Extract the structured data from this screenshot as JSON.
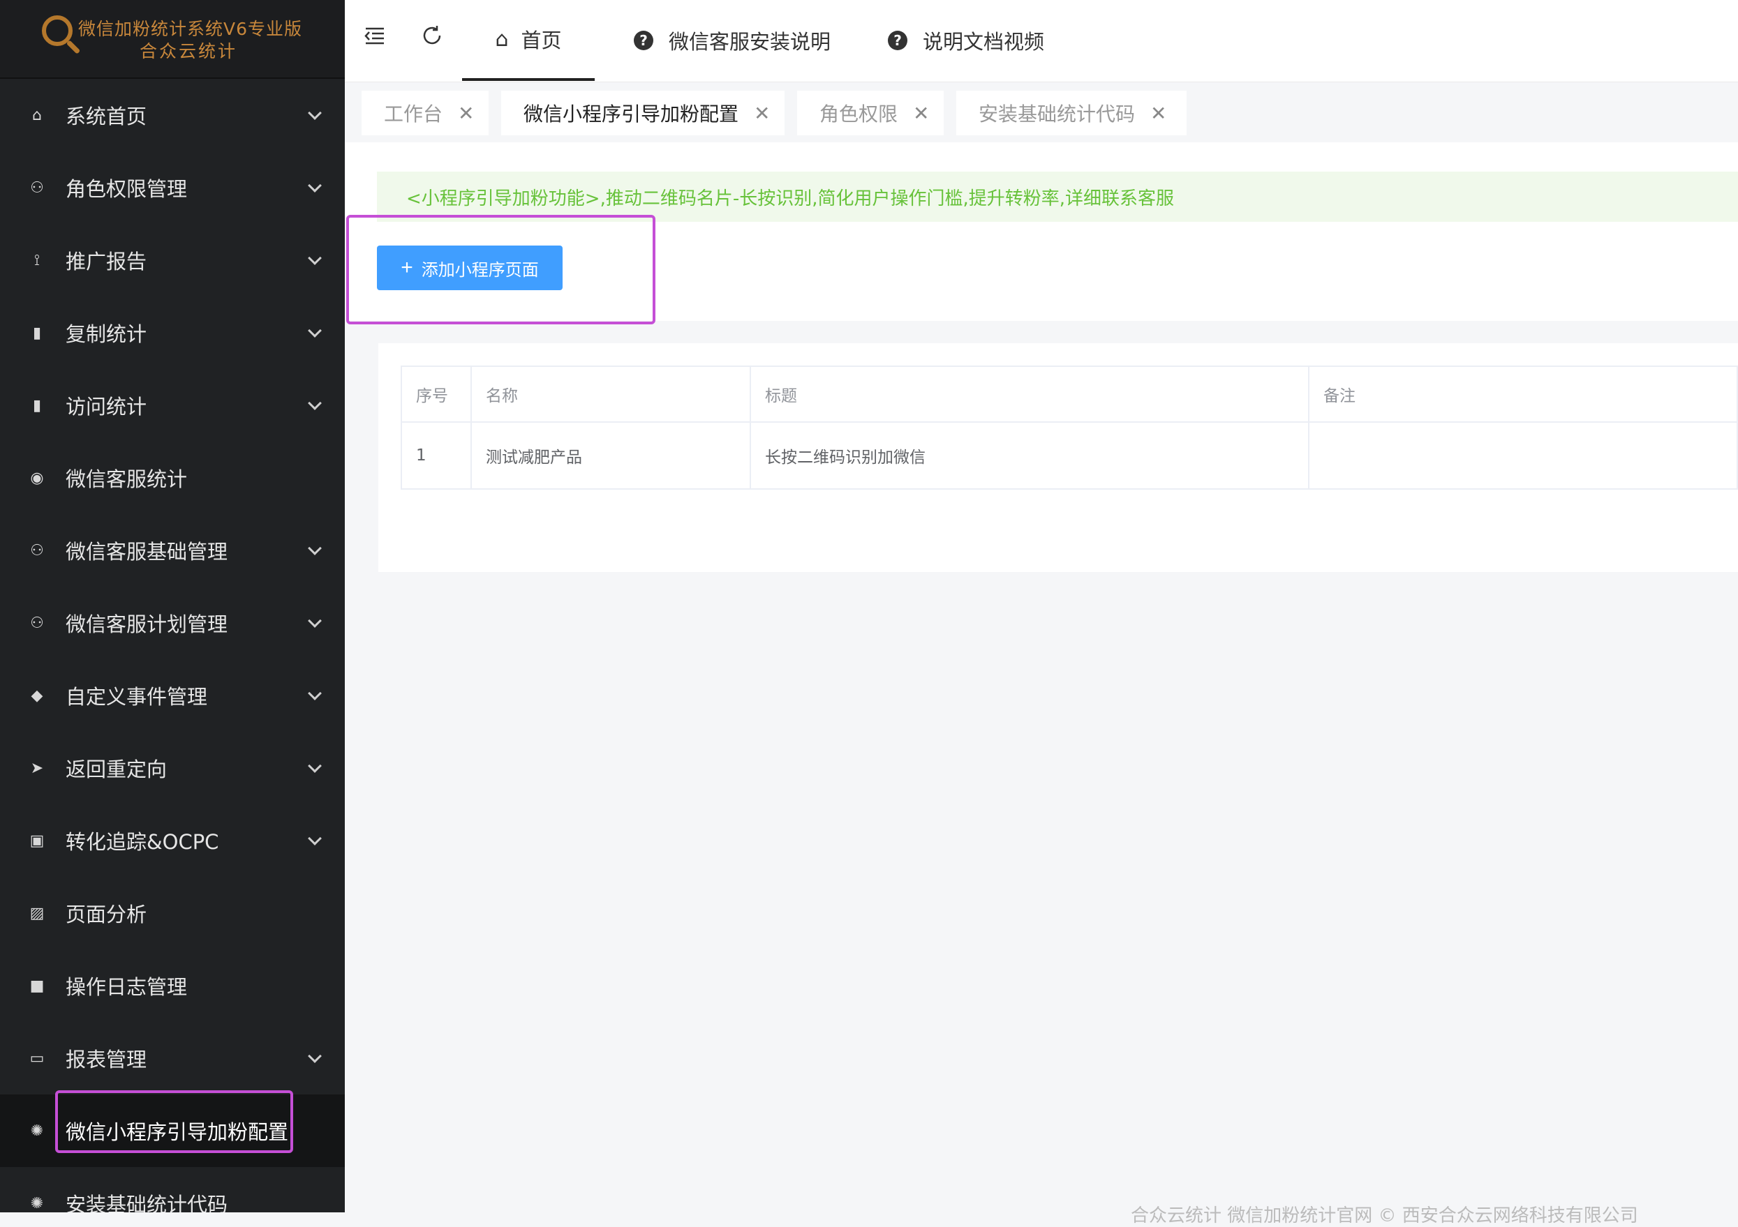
{
  "logo": {
    "line1": "微信加粉统计系统V6专业版",
    "line2": "合众云统计"
  },
  "sidebar": {
    "items": [
      {
        "label": "系统首页",
        "icon": "home-icon",
        "glyph": "⌂",
        "expandable": true
      },
      {
        "label": "角色权限管理",
        "icon": "user-add-icon",
        "glyph": "⚇",
        "expandable": true
      },
      {
        "label": "推广报告",
        "icon": "route-icon",
        "glyph": "⟟",
        "expandable": true
      },
      {
        "label": "复制统计",
        "icon": "bar-chart-icon",
        "glyph": "▮",
        "expandable": true
      },
      {
        "label": "访问统计",
        "icon": "stats-icon",
        "glyph": "▮",
        "expandable": true
      },
      {
        "label": "微信客服统计",
        "icon": "user-circle-icon",
        "glyph": "◉",
        "expandable": false
      },
      {
        "label": "微信客服基础管理",
        "icon": "users-icon",
        "glyph": "⚇",
        "expandable": true
      },
      {
        "label": "微信客服计划管理",
        "icon": "group-icon",
        "glyph": "⚇",
        "expandable": true
      },
      {
        "label": "自定义事件管理",
        "icon": "cube-icon",
        "glyph": "◆",
        "expandable": true
      },
      {
        "label": "返回重定向",
        "icon": "send-icon",
        "glyph": "➤",
        "expandable": true
      },
      {
        "label": "转化追踪&OCPC",
        "icon": "inbox-icon",
        "glyph": "▣",
        "expandable": true
      },
      {
        "label": "页面分析",
        "icon": "chart-picture-icon",
        "glyph": "▨",
        "expandable": false
      },
      {
        "label": "操作日志管理",
        "icon": "video-icon",
        "glyph": "■",
        "expandable": false
      },
      {
        "label": "报表管理",
        "icon": "card-icon",
        "glyph": "▭",
        "expandable": true
      },
      {
        "label": "微信小程序引导加粉配置",
        "icon": "gear-icon",
        "glyph": "✺",
        "expandable": false,
        "active": true
      },
      {
        "label": "安装基础统计代码",
        "icon": "gear-icon",
        "glyph": "✺",
        "expandable": false
      }
    ]
  },
  "topbar": {
    "tabs": [
      {
        "label": "首页",
        "icon": "home-icon"
      },
      {
        "label": "微信客服安装说明",
        "icon": "question-icon"
      },
      {
        "label": "说明文档视频",
        "icon": "question-icon"
      }
    ]
  },
  "page_tabs": [
    {
      "label": "工作台"
    },
    {
      "label": "微信小程序引导加粉配置"
    },
    {
      "label": "角色权限"
    },
    {
      "label": "安装基础统计代码"
    }
  ],
  "notice": "<小程序引导加粉功能>,推动二维码名片-长按识别,简化用户操作门槛,提升转粉率,详细联系客服",
  "add_button": "添加小程序页面",
  "table": {
    "headers": [
      "序号",
      "名称",
      "标题",
      "备注"
    ],
    "rows": [
      [
        "1",
        "测试减肥产品",
        "长按二维码识别加微信",
        ""
      ]
    ]
  },
  "footer": "合众云统计 微信加粉统计官网 © 西安合众云网络科技有限公司"
}
